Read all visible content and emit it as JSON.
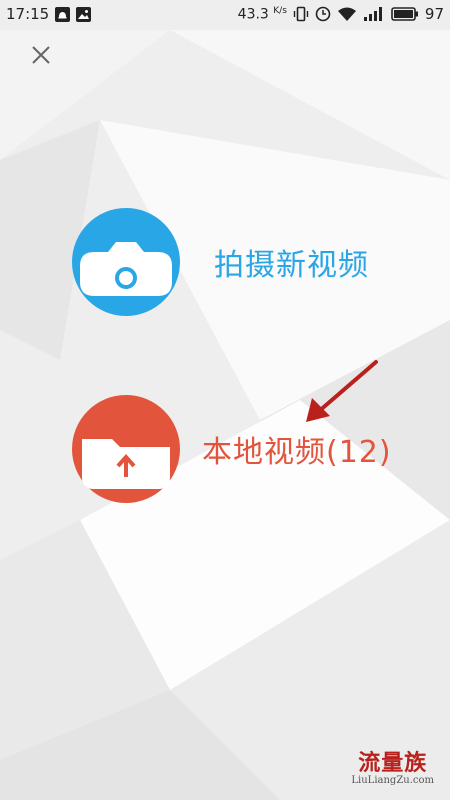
{
  "status_bar": {
    "time": "17:15",
    "net_speed": "43.3",
    "net_speed_unit": "K/s",
    "battery": "97",
    "icons": [
      "notification-icon",
      "image-icon",
      "vibrate-icon",
      "alarm-icon",
      "wifi-icon",
      "signal-icon",
      "battery-icon"
    ]
  },
  "close": {
    "icon": "close-icon"
  },
  "options": [
    {
      "label": "拍摄新视频",
      "icon": "camera-icon",
      "color": "#29a6e6"
    },
    {
      "label": "本地视频(12)",
      "icon": "folder-upload-icon",
      "color": "#e2553c"
    }
  ],
  "annotation": {
    "icon": "arrow-annotation",
    "color": "#b8211c"
  },
  "watermark": {
    "cn": "流量族",
    "en": "LiuLiangZu.com"
  }
}
